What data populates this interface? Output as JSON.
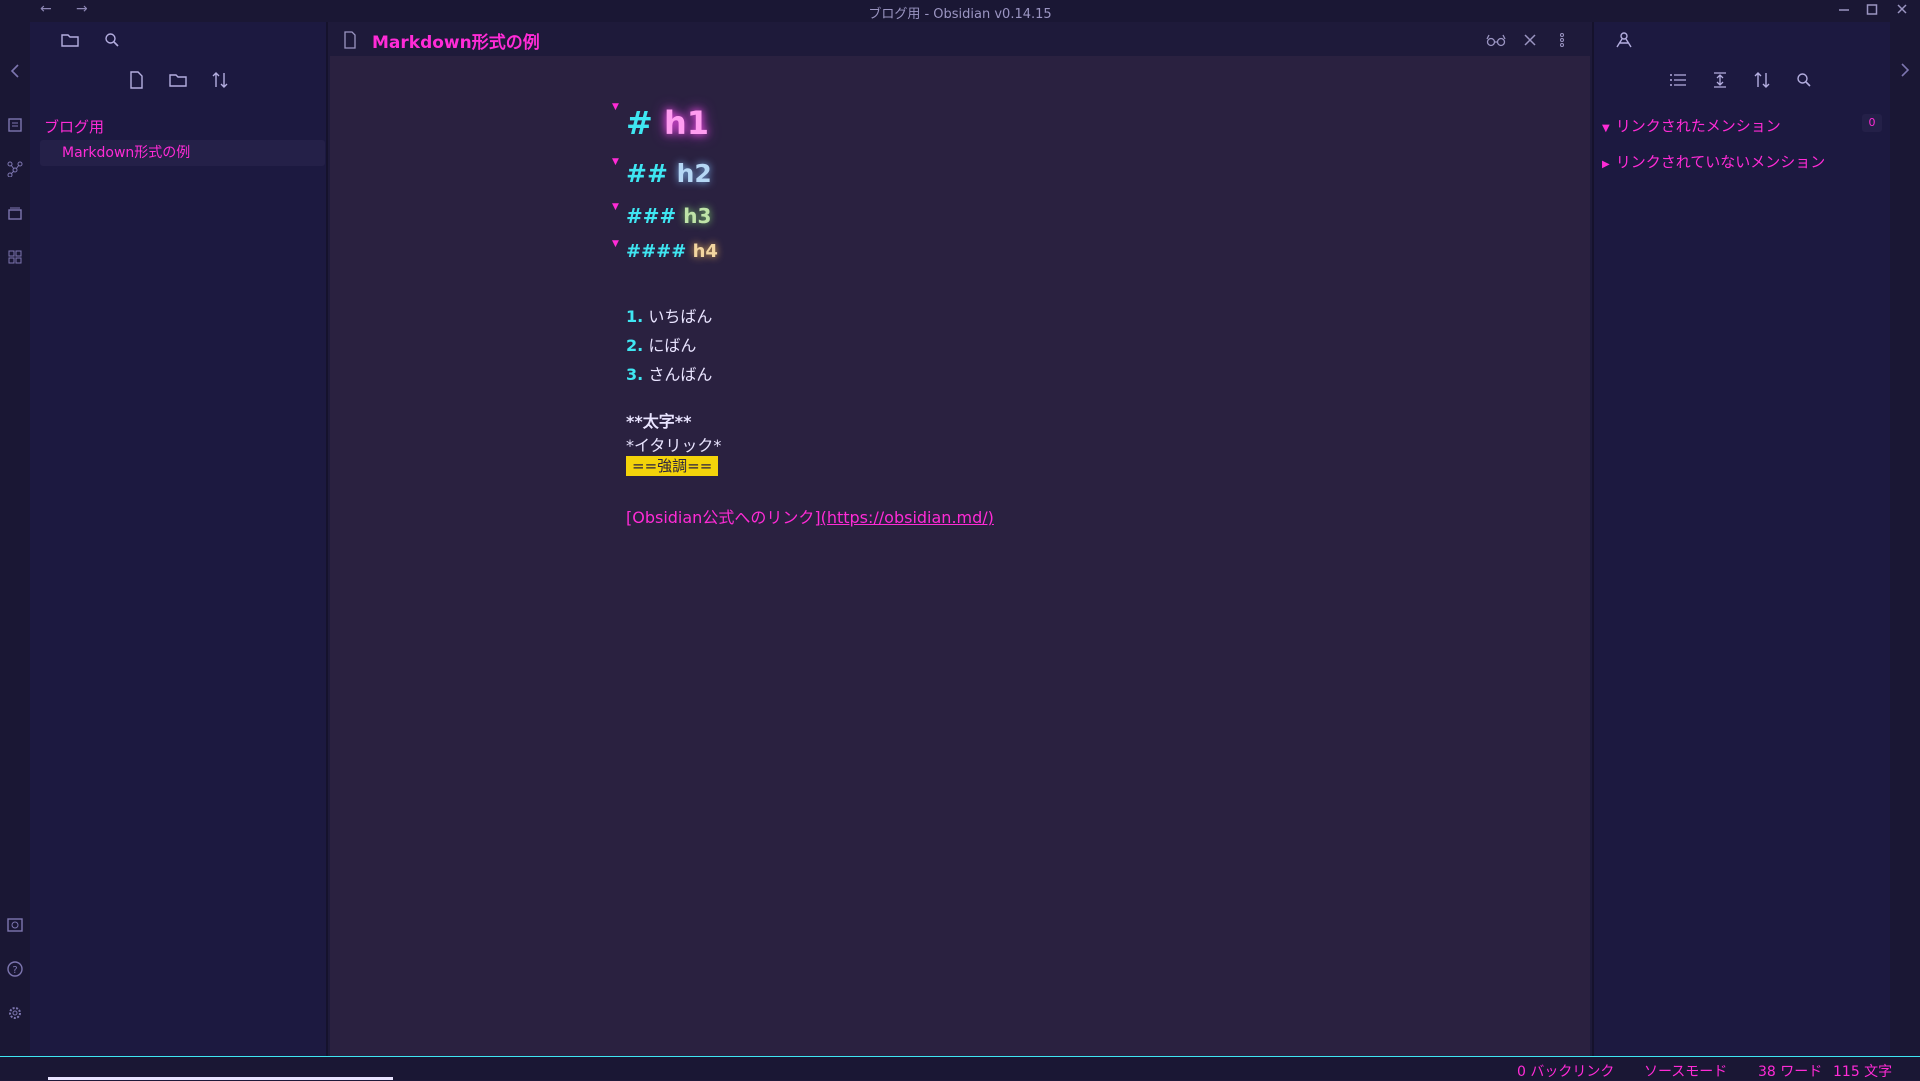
{
  "window": {
    "title": "ブログ用 - Obsidian v0.14.15",
    "back_arrow": "←",
    "forward_arrow": "→",
    "controls": [
      "minimize-icon",
      "maximize-icon",
      "close-icon"
    ]
  },
  "colors": {
    "accent": "#ff2bd6",
    "cyan": "#3fe6f2",
    "highlight": "#f3d30a",
    "background": "#2a2140",
    "panel": "#1c1940"
  },
  "ribbon": {
    "icons": [
      "collapse-left-icon",
      "document-icon",
      "graph-icon",
      "cards-icon",
      "plugins-icon",
      "vault-icon",
      "help-icon",
      "settings-icon"
    ]
  },
  "left_panel": {
    "tabs": [
      "folder-icon",
      "search-icon"
    ],
    "actions": [
      "new-note-icon",
      "new-folder-icon",
      "sort-icon"
    ],
    "folder": "ブログ用",
    "file": "Markdown形式の例"
  },
  "editor": {
    "title": "Markdown形式の例",
    "header_actions": [
      "reading-view-icon",
      "close-icon",
      "more-icon"
    ],
    "headings": [
      {
        "mark": "#",
        "text": "h1"
      },
      {
        "mark": "##",
        "text": "h2"
      },
      {
        "mark": "###",
        "text": "h3"
      },
      {
        "mark": "####",
        "text": "h4"
      }
    ],
    "list": [
      {
        "num": "1.",
        "text": "いちばん"
      },
      {
        "num": "2.",
        "text": "にばん"
      },
      {
        "num": "3.",
        "text": "さんばん"
      }
    ],
    "bold": "**太字**",
    "italic": "*イタリック*",
    "highlight": "==強調==",
    "link_text": "[Obsidian公式へのリンク]",
    "link_url": "(https://obsidian.md/)"
  },
  "right_panel": {
    "tab": "backlinks-icon",
    "actions": [
      "list-icon",
      "collapse-icon",
      "sort-icon",
      "search-icon"
    ],
    "linked_mentions": "リンクされたメンション",
    "linked_count": "0",
    "unlinked_mentions": "リンクされていないメンション"
  },
  "status_bar": {
    "backlinks": "0 バックリンク",
    "mode": "ソースモード",
    "words": "38 ワード",
    "chars": "115 文字"
  }
}
